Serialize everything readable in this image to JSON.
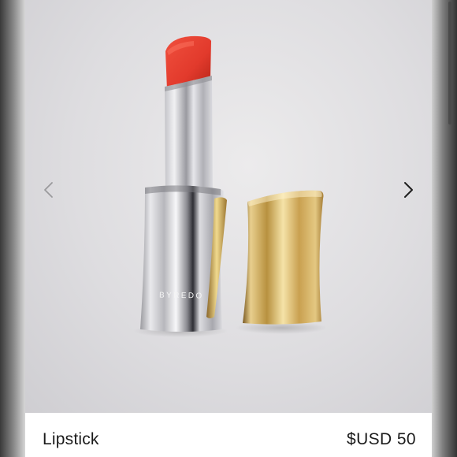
{
  "gallery": {
    "brand_text": "BYREDO",
    "prev_icon": "chevron-left-icon",
    "next_icon": "chevron-right-icon"
  },
  "listing": {
    "title": "Lipstick",
    "price": "$USD 50"
  },
  "colors": {
    "lipstick_red": "#e23a2c",
    "cap_gold": "#c9a050",
    "body_silver": "#c8c8cc"
  }
}
